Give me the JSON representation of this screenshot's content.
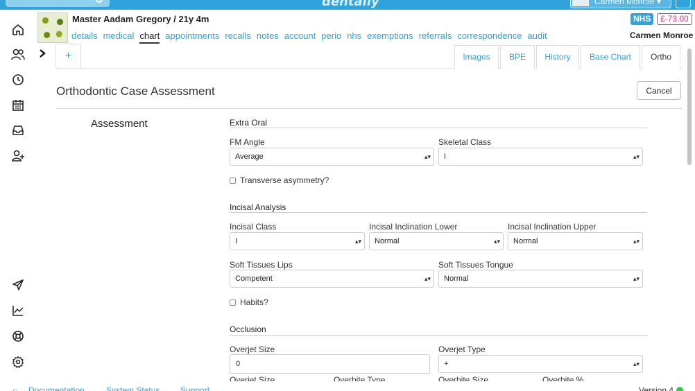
{
  "topbar": {
    "brand": "dentally",
    "user": "Carmen Monroe ▾"
  },
  "patient": {
    "name": "Master Aadam Gregory / 21y 4m",
    "tabs": [
      "details",
      "medical",
      "chart",
      "appointments",
      "recalls",
      "notes",
      "account",
      "perio",
      "nhs",
      "exemptions",
      "referrals",
      "correspondence",
      "audit"
    ],
    "active_tab": "chart",
    "nhs_badge": "NHS",
    "balance": "£-73.00",
    "dentist": "Carmen Monroe"
  },
  "chart_tabs": {
    "add": "+",
    "items": [
      "Images",
      "BPE",
      "History",
      "Base Chart",
      "Ortho"
    ],
    "active": "Ortho"
  },
  "form": {
    "title": "Orthodontic Case Assessment",
    "cancel": "Cancel",
    "section": "Assessment",
    "extra_oral": {
      "title": "Extra Oral",
      "fm_angle_label": "FM Angle",
      "fm_angle_value": "Average",
      "skeletal_class_label": "Skeletal Class",
      "skeletal_class_value": "I",
      "transverse_label": "Transverse asymmetry?"
    },
    "incisal": {
      "title": "Incisal Analysis",
      "class_label": "Incisal Class",
      "class_value": "I",
      "incl_lower_label": "Incisal Inclination Lower",
      "incl_lower_value": "Normal",
      "incl_upper_label": "Incisal Inclination Upper",
      "incl_upper_value": "Normal",
      "lips_label": "Soft Tissues Lips",
      "lips_value": "Competent",
      "tongue_label": "Soft Tissues Tongue",
      "tongue_value": "Normal",
      "habits_label": "Habits?"
    },
    "occlusion": {
      "title": "Occlusion",
      "overjet_size_label": "Overjet Size",
      "overjet_size_value": "0",
      "overjet_type_label": "Overjet Type",
      "overjet_type_value": "+",
      "row2": [
        "Overjet Size",
        "Overbite Type",
        "Overbite Size",
        "Overbite %"
      ]
    }
  },
  "footer": {
    "links": [
      "Documentation",
      "System Status",
      "Support"
    ],
    "version": "Version 4"
  }
}
